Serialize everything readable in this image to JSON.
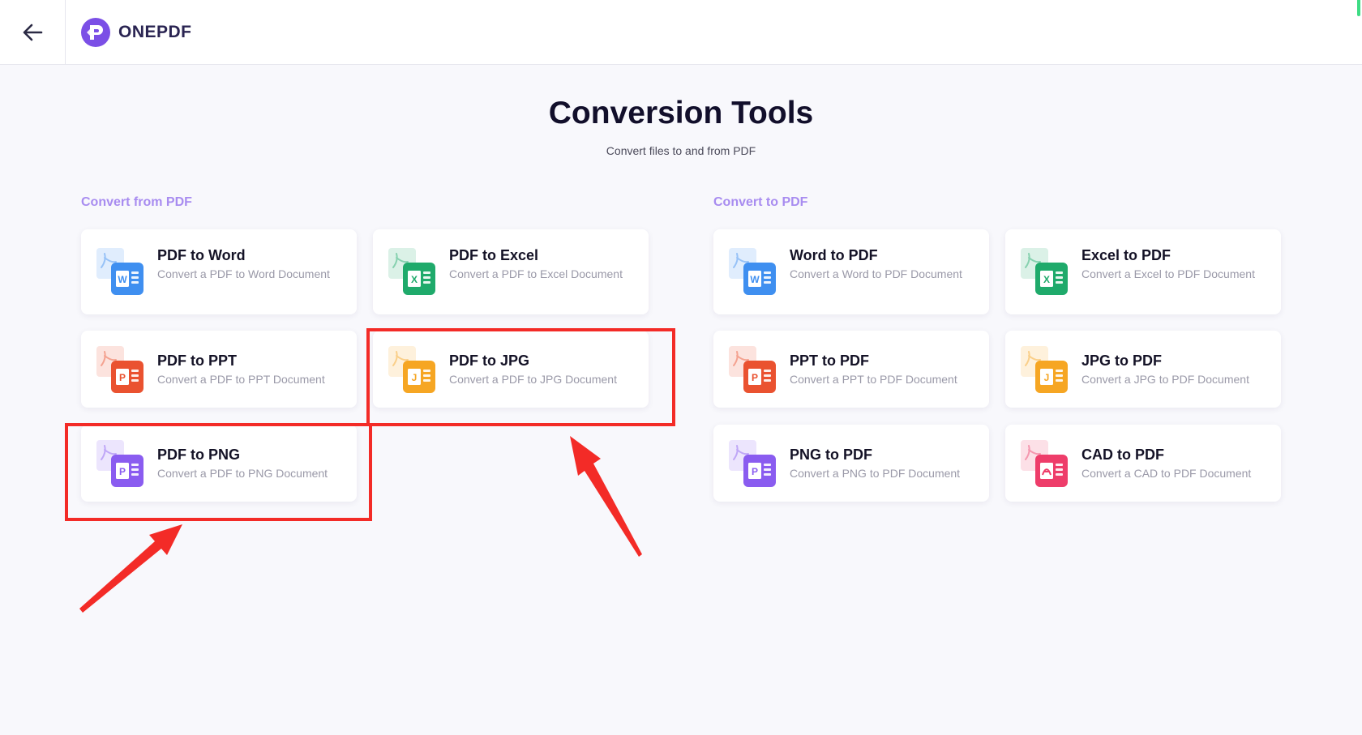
{
  "app": {
    "name": "ONEPDF"
  },
  "page": {
    "title": "Conversion Tools",
    "subtitle": "Convert files to and from PDF"
  },
  "sections": {
    "from_pdf": {
      "label": "Convert from PDF",
      "tools": [
        {
          "title": "PDF to Word",
          "desc": "Convert a PDF to Word Document",
          "icon": "word-icon",
          "color": "#3f8ff0",
          "letter": "W"
        },
        {
          "title": "PDF to Excel",
          "desc": "Convert a PDF to Excel Document",
          "icon": "excel-icon",
          "color": "#1faa6b",
          "letter": "X"
        },
        {
          "title": "PDF to PPT",
          "desc": "Convert a PDF to PPT Document",
          "icon": "ppt-icon",
          "color": "#ea5230",
          "letter": "P"
        },
        {
          "title": "PDF to JPG",
          "desc": "Convert a PDF to JPG Document",
          "icon": "jpg-icon",
          "color": "#f6a623",
          "letter": "J"
        },
        {
          "title": "PDF to PNG",
          "desc": "Convert a PDF to PNG Document",
          "icon": "png-icon",
          "color": "#8a5cf0",
          "letter": "P"
        }
      ]
    },
    "to_pdf": {
      "label": "Convert to PDF",
      "tools": [
        {
          "title": "Word to PDF",
          "desc": "Convert a Word to PDF Document",
          "icon": "word-icon",
          "color": "#3f8ff0",
          "letter": "W"
        },
        {
          "title": "Excel to PDF",
          "desc": "Convert a Excel to PDF Document",
          "icon": "excel-icon",
          "color": "#1faa6b",
          "letter": "X"
        },
        {
          "title": "PPT to PDF",
          "desc": "Convert a PPT to PDF Document",
          "icon": "ppt-icon",
          "color": "#ea5230",
          "letter": "P"
        },
        {
          "title": "JPG to PDF",
          "desc": "Convert a JPG to PDF Document",
          "icon": "jpg-icon",
          "color": "#f6a623",
          "letter": "J"
        },
        {
          "title": "PNG to PDF",
          "desc": "Convert a PNG to PDF Document",
          "icon": "png-icon",
          "color": "#8a5cf0",
          "letter": "P"
        },
        {
          "title": "CAD to PDF",
          "desc": "Convert a CAD to PDF Document",
          "icon": "cad-icon",
          "color": "#ee3d6a",
          "letter": "A"
        }
      ]
    }
  },
  "colors": {
    "accent": "#a88cf0",
    "brand": "#8a5cf0",
    "annotation": "#f32b27"
  }
}
